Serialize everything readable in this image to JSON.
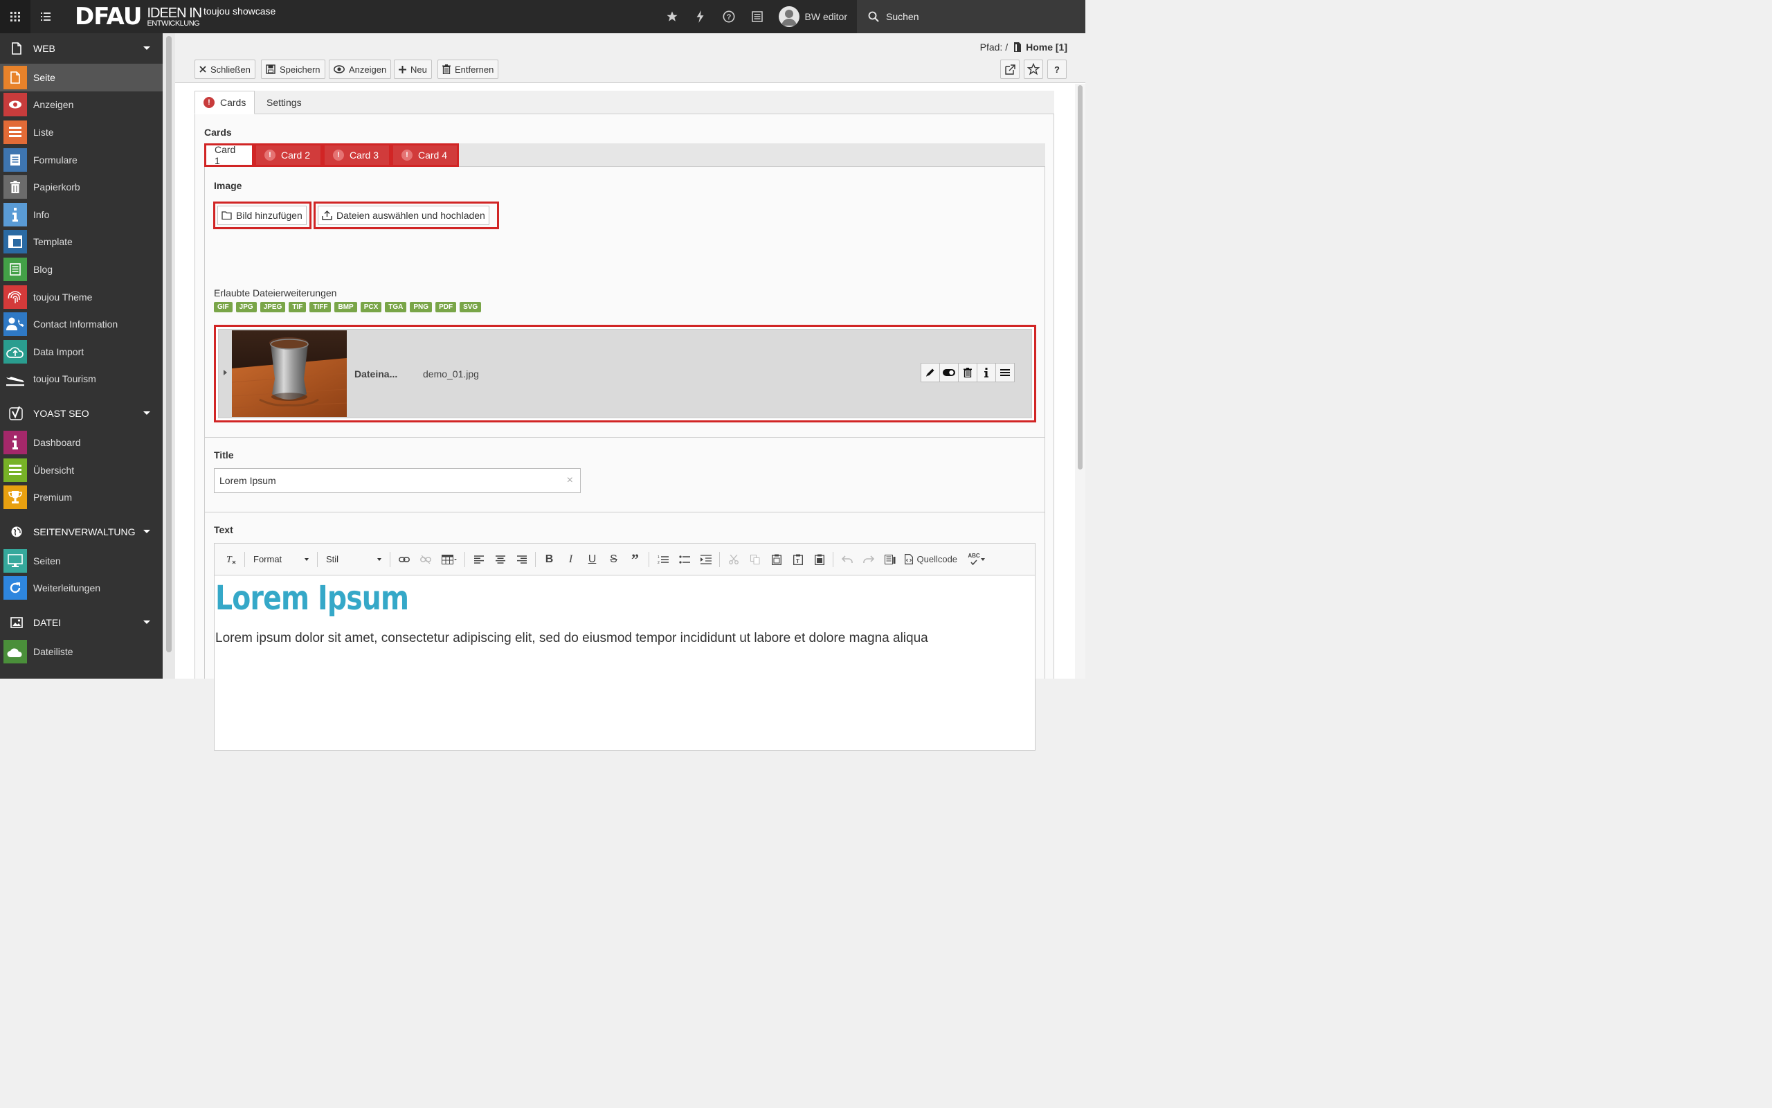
{
  "topbar": {
    "logo_main": "DFAU",
    "logo_sub_1": "IDEEN IN",
    "logo_sub_2": "ENTWICKLUNG",
    "site_name": "toujou showcase",
    "user_name": "BW editor",
    "search_label": "Suchen"
  },
  "sidebar": {
    "groups": [
      {
        "label": "WEB",
        "icon": "page-icon",
        "items": [
          {
            "label": "Seite",
            "icon": "page-icon",
            "color": "#e8822a",
            "active": true
          },
          {
            "label": "Anzeigen",
            "icon": "eye-icon",
            "color": "#c83c3c"
          },
          {
            "label": "Liste",
            "icon": "list-icon",
            "color": "#e26b37"
          },
          {
            "label": "Formulare",
            "icon": "form-icon",
            "color": "#3e75b0"
          },
          {
            "label": "Papierkorb",
            "icon": "trash-icon",
            "color": "#6b6b6b"
          },
          {
            "label": "Info",
            "icon": "info-icon",
            "color": "#5a9bd5"
          },
          {
            "label": "Template",
            "icon": "template-icon",
            "color": "#2a6aa3"
          },
          {
            "label": "Blog",
            "icon": "blog-icon",
            "color": "#43a047"
          },
          {
            "label": "toujou Theme",
            "icon": "fingerprint-icon",
            "color": "#d43a3a"
          },
          {
            "label": "Contact Information",
            "icon": "contact-icon",
            "color": "#2f79c5"
          },
          {
            "label": "Data Import",
            "icon": "cloud-upload-icon",
            "color": "#2a9d8f"
          },
          {
            "label": "toujou Tourism",
            "icon": "plane-icon",
            "color": "#333333"
          }
        ]
      },
      {
        "label": "YOAST SEO",
        "icon": "yoast-icon",
        "items": [
          {
            "label": "Dashboard",
            "icon": "info-icon",
            "color": "#a4286a"
          },
          {
            "label": "Übersicht",
            "icon": "list-icon",
            "color": "#77b227"
          },
          {
            "label": "Premium",
            "icon": "trophy-icon",
            "color": "#e8a010"
          }
        ]
      },
      {
        "label": "SEITENVERWALTUNG",
        "icon": "globe-icon",
        "items": [
          {
            "label": "Seiten",
            "icon": "monitor-icon",
            "color": "#36a89c"
          },
          {
            "label": "Weiterleitungen",
            "icon": "redirect-icon",
            "color": "#2e86de"
          }
        ]
      },
      {
        "label": "DATEI",
        "icon": "image-icon",
        "items": [
          {
            "label": "Dateiliste",
            "icon": "cloud-file-icon",
            "color": "#4a8f3a"
          }
        ]
      }
    ]
  },
  "docheader": {
    "path_label": "Pfad: /",
    "path_page": "Home [1]",
    "buttons": {
      "close": "Schließen",
      "save": "Speichern",
      "view": "Anzeigen",
      "new": "Neu",
      "delete": "Entfernen"
    },
    "help": "?"
  },
  "tabs": {
    "cards": "Cards",
    "settings": "Settings"
  },
  "cards_section": {
    "label": "Cards",
    "card_tabs": [
      "Card 1",
      "Card 2",
      "Card 3",
      "Card 4"
    ]
  },
  "image_field": {
    "label": "Image",
    "add_button": "Bild hinzufügen",
    "upload_button": "Dateien auswählen und hochladen",
    "allowed_label": "Erlaubte Dateierweiterungen",
    "extensions": [
      "GIF",
      "JPG",
      "JPEG",
      "TIF",
      "TIFF",
      "BMP",
      "PCX",
      "TGA",
      "PNG",
      "PDF",
      "SVG"
    ],
    "file_label": "Dateina...",
    "file_name": "demo_01.jpg"
  },
  "title_field": {
    "label": "Title",
    "value": "Lorem Ipsum",
    "clear": "×"
  },
  "text_field": {
    "label": "Text",
    "format_combo": "Format",
    "style_combo": "Stil",
    "source_label": "Quellcode",
    "spell_label": "ABC",
    "heading": "Lorem Ipsum",
    "paragraph": "Lorem ipsum dolor sit amet, consectetur adipiscing elit, sed do eiusmod tempor incididunt ut labore et dolore magna aliqua"
  },
  "colors": {
    "error_red": "#d12525",
    "accent_blue": "#35a8c8",
    "ext_green": "#79a548"
  }
}
